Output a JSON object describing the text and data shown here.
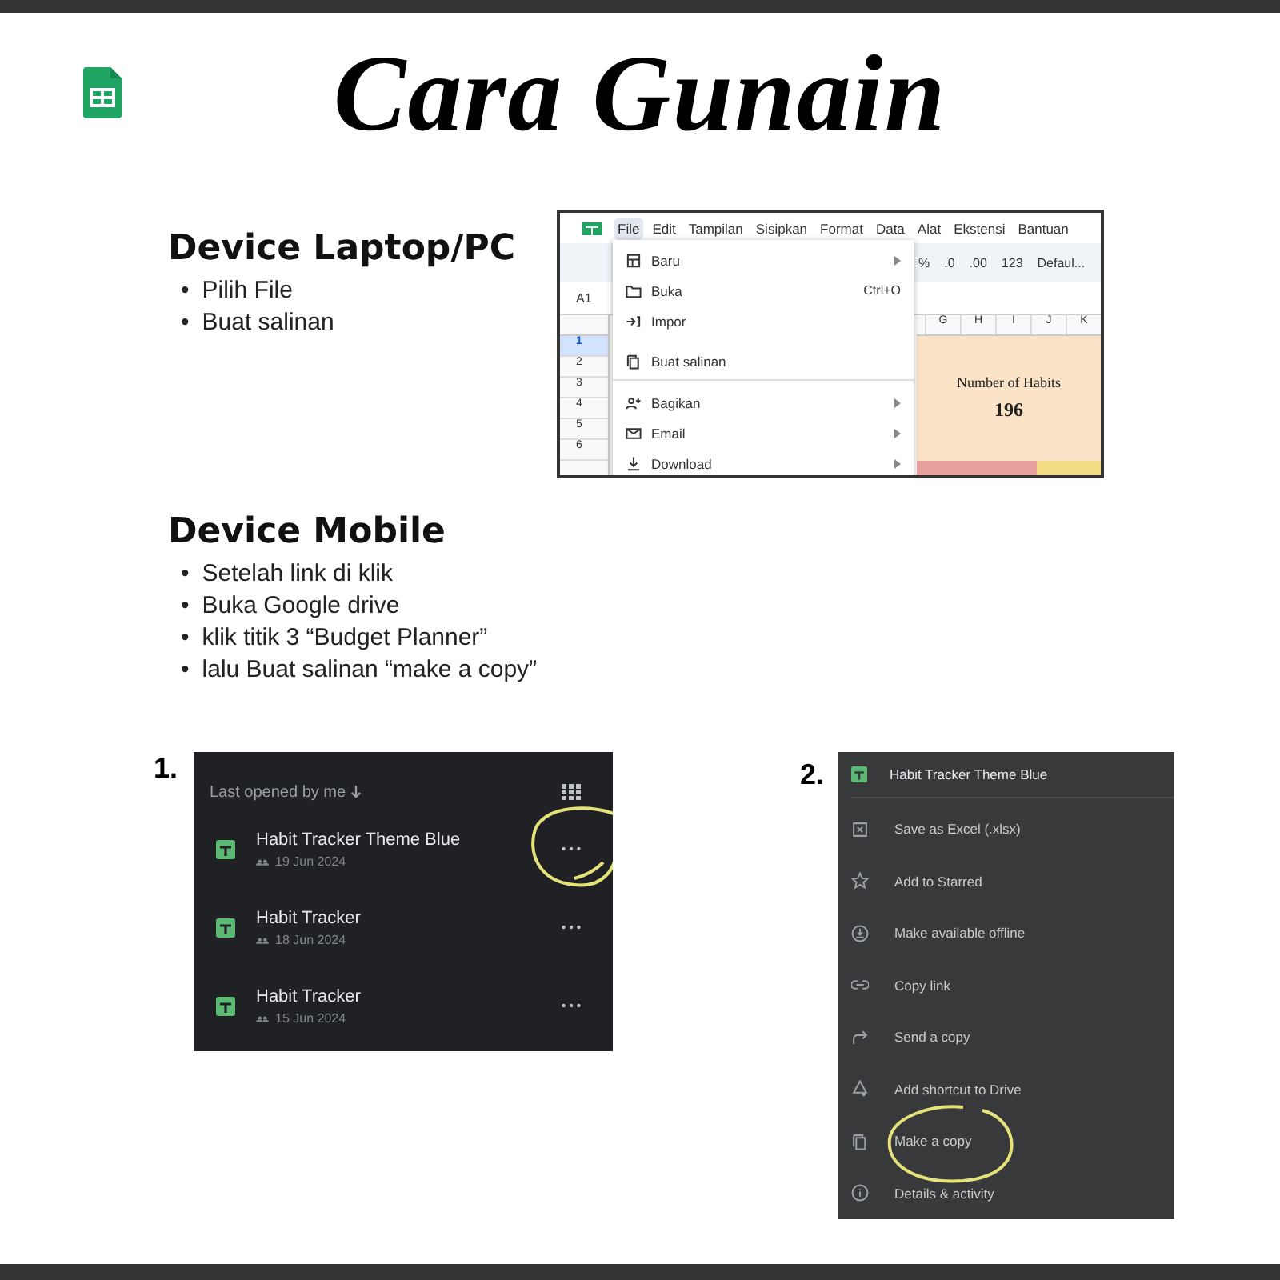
{
  "header": {
    "title": "Cara Gunain"
  },
  "laptop": {
    "heading": "Device Laptop/PC",
    "bullets": [
      {
        "marker": "•",
        "text": "Pilih File"
      },
      {
        "marker": "•",
        "text": "Buat salinan"
      }
    ],
    "screen": {
      "menubar": [
        {
          "label": "File",
          "selected": true
        },
        {
          "label": "Edit",
          "selected": false
        },
        {
          "label": "Tampilan",
          "selected": false
        },
        {
          "label": "Sisipkan",
          "selected": false
        },
        {
          "label": "Format",
          "selected": false
        },
        {
          "label": "Data",
          "selected": false
        },
        {
          "label": "Alat",
          "selected": false
        },
        {
          "label": "Ekstensi",
          "selected": false
        },
        {
          "label": "Bantuan",
          "selected": false
        }
      ],
      "toolbar": [
        "%",
        ".0",
        ".00",
        "123",
        "Defaul..."
      ],
      "cell_ref": "A1",
      "column_headers": [
        "G",
        "H",
        "I",
        "J",
        "K"
      ],
      "row_numbers": [
        {
          "label": "1",
          "selected": true
        },
        {
          "label": "2",
          "selected": false
        },
        {
          "label": "3",
          "selected": false
        },
        {
          "label": "4",
          "selected": false
        },
        {
          "label": "5",
          "selected": false
        },
        {
          "label": "6",
          "selected": false
        }
      ],
      "summary": {
        "label": "Number of Habits",
        "value": "196"
      },
      "file_menu": [
        {
          "kind": "new",
          "label": "Baru",
          "submenu": true,
          "divider_after": false
        },
        {
          "kind": "folder",
          "label": "Buka",
          "shortcut": "Ctrl+O",
          "submenu": false,
          "divider_after": false
        },
        {
          "kind": "import",
          "label": "Impor",
          "submenu": false,
          "divider_after": false
        },
        {
          "kind": "copy",
          "label": "Buat salinan",
          "submenu": false,
          "divider_after": true
        },
        {
          "kind": "share",
          "label": "Bagikan",
          "submenu": true,
          "divider_after": false
        },
        {
          "kind": "email",
          "label": "Email",
          "submenu": true,
          "divider_after": false
        },
        {
          "kind": "download",
          "label": "Download",
          "submenu": true,
          "divider_after": false
        }
      ]
    }
  },
  "mobile": {
    "heading": "Device Mobile",
    "bullets": [
      {
        "marker": "•",
        "text": "Setelah link di klik"
      },
      {
        "marker": "•",
        "text": "Buka Google drive"
      },
      {
        "marker": "•",
        "text": "klik titik 3 “Budget Planner”"
      },
      {
        "marker": "•",
        "text": "lalu Buat salinan “make a copy”"
      }
    ],
    "step_1": {
      "number": "1.",
      "sort_label": "Last opened by me",
      "files": [
        {
          "title": "Habit Tracker Theme Blue",
          "date": "19 Jun 2024",
          "circled": true
        },
        {
          "title": "Habit Tracker",
          "date": "18 Jun 2024",
          "circled": false
        },
        {
          "title": "Habit Tracker",
          "date": "15 Jun 2024",
          "circled": false
        }
      ]
    },
    "step_2": {
      "number": "2.",
      "title": "Habit Tracker Theme Blue",
      "actions": [
        {
          "kind": "excel",
          "label": "Save as Excel (.xlsx)",
          "circled": false
        },
        {
          "kind": "star",
          "label": "Add to Starred",
          "circled": false
        },
        {
          "kind": "offline",
          "label": "Make available offline",
          "circled": false
        },
        {
          "kind": "link",
          "label": "Copy link",
          "circled": false
        },
        {
          "kind": "send",
          "label": "Send a copy",
          "circled": false
        },
        {
          "kind": "shortcut",
          "label": "Add shortcut to Drive",
          "circled": false
        },
        {
          "kind": "copy",
          "label": "Make a copy",
          "circled": true
        },
        {
          "kind": "info",
          "label": "Details & activity",
          "circled": false
        }
      ]
    }
  }
}
